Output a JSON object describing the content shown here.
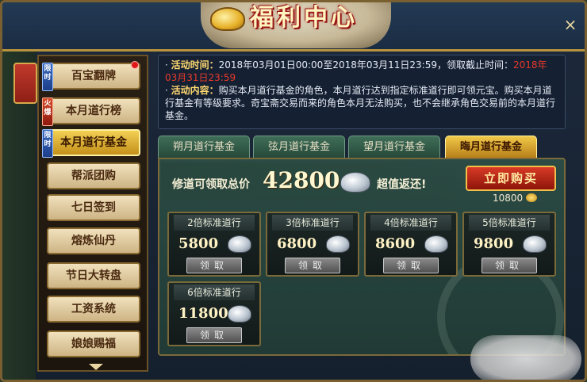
{
  "window": {
    "title": "福利中心",
    "close_label": "×"
  },
  "sidebar": {
    "items": [
      {
        "label": "百宝翻牌",
        "tag": "限时",
        "tag_color": "blue",
        "badge": true
      },
      {
        "label": "本月道行榜",
        "tag": "火爆",
        "tag_color": "red"
      },
      {
        "label": "本月道行基金",
        "tag": "限时",
        "tag_color": "blue",
        "active": true
      },
      {
        "label": "帮派团购"
      },
      {
        "label": "七日签到"
      },
      {
        "label": "熔炼仙丹"
      },
      {
        "label": "节日大转盘"
      },
      {
        "label": "工资系统"
      },
      {
        "label": "娘娘赐福"
      }
    ]
  },
  "info": {
    "time_label": "活动时间：",
    "time_text": "2018年03月01日00:00至2018年03月11日23:59，领取截止时间：",
    "time_deadline": "2018年03月31日23:59",
    "content_label": "活动内容：",
    "content_text": "购买本月道行基金的角色，本月道行达到指定标准道行即可领元宝。购买本月道行基金有等级要求。奇宝斋交易而来的角色本月无法购买，也不会继承角色交易前的本月道行基金。"
  },
  "tabs": [
    {
      "label": "朔月道行基金"
    },
    {
      "label": "弦月道行基金"
    },
    {
      "label": "望月道行基金"
    },
    {
      "label": "晦月道行基金",
      "active": true
    }
  ],
  "banner": {
    "pre": "修道可领取总价",
    "total": "42800",
    "post": "超值返还!"
  },
  "buy": {
    "label": "立即购买",
    "price": "10800"
  },
  "rewards": [
    {
      "title": "2倍标准道行",
      "amount": "5800",
      "claim": "领取"
    },
    {
      "title": "3倍标准道行",
      "amount": "6800",
      "claim": "领取"
    },
    {
      "title": "4倍标准道行",
      "amount": "8600",
      "claim": "领取"
    },
    {
      "title": "5倍标准道行",
      "amount": "9800",
      "claim": "领取"
    },
    {
      "title": "6倍标准道行",
      "amount": "11800",
      "claim": "领取"
    }
  ]
}
